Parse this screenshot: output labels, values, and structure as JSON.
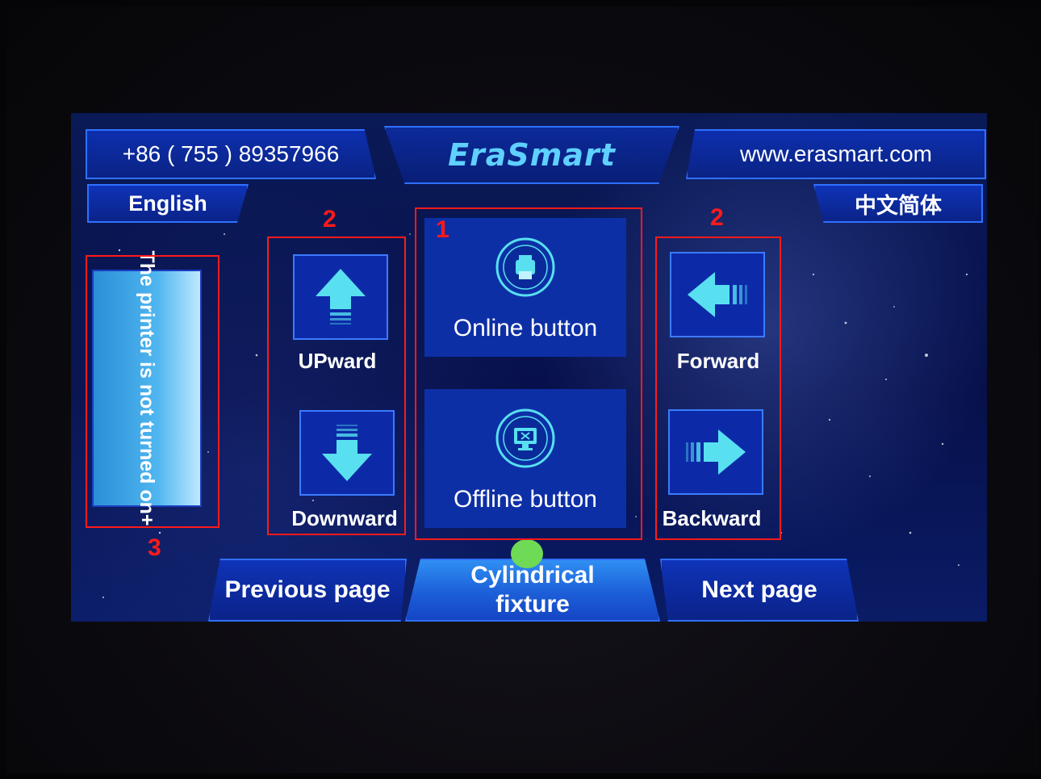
{
  "header": {
    "phone": "+86 ( 755 ) 89357966",
    "brand": "EraSmart",
    "website": "www.erasmart.com"
  },
  "language": {
    "english": "English",
    "chinese": "中文简体"
  },
  "status": {
    "message": "The printer is not turned on+"
  },
  "center": {
    "online_label": "Online button",
    "offline_label": "Offline button"
  },
  "vertical": {
    "up_label": "UPward",
    "down_label": "Downward"
  },
  "horizontal": {
    "forward_label": "Forward",
    "backward_label": "Backward"
  },
  "footer": {
    "previous_label": "Previous page",
    "mode_label": "Cylindrical fixture",
    "next_label": "Next page"
  },
  "annotations": {
    "box1": "1",
    "box2_left": "2",
    "box2_right": "2",
    "box3": "3"
  },
  "colors": {
    "screen_bg": "#07104a",
    "button_blue": "#0c2aa8",
    "accent_cyan": "#5fd0ff",
    "annotation_red": "#ff1a1a",
    "indicator_green": "#6fda55"
  }
}
